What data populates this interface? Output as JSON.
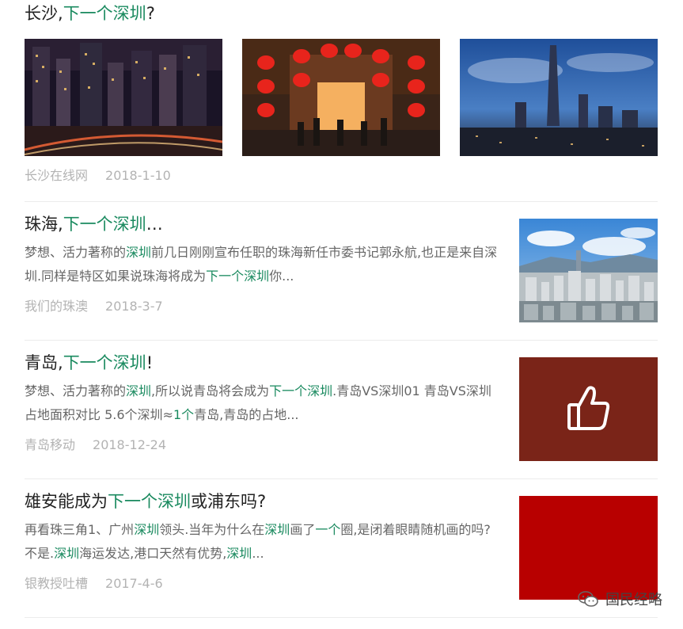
{
  "items": [
    {
      "title_parts": [
        {
          "text": "长沙,",
          "hl": false
        },
        {
          "text": "下一个深圳",
          "hl": true
        },
        {
          "text": "?",
          "hl": false
        }
      ],
      "images": [
        "changsha-night-skyline",
        "temple-lanterns-street",
        "shenzhen-dusk-skyline"
      ],
      "source": "长沙在线网",
      "date": "2018-1-10"
    },
    {
      "title_parts": [
        {
          "text": "珠海,",
          "hl": false
        },
        {
          "text": "下一个深圳",
          "hl": true
        },
        {
          "text": "…",
          "hl": false
        }
      ],
      "desc_parts": [
        {
          "text": "梦想、活力著称的",
          "hl": false
        },
        {
          "text": "深圳",
          "hl": true
        },
        {
          "text": "前几日刚刚宣布任职的珠海新任市委书记郭永航,也正是来自深圳.同样是特区如果说珠海将成为",
          "hl": false
        },
        {
          "text": "下一个深圳",
          "hl": true
        },
        {
          "text": "你...",
          "hl": false
        }
      ],
      "image": "city-panorama-blue-sky",
      "source": "我们的珠澳",
      "date": "2018-3-7"
    },
    {
      "title_parts": [
        {
          "text": "青岛,",
          "hl": false
        },
        {
          "text": "下一个深圳",
          "hl": true
        },
        {
          "text": "!",
          "hl": false
        }
      ],
      "desc_parts": [
        {
          "text": "梦想、活力著称的",
          "hl": false
        },
        {
          "text": "深圳",
          "hl": true
        },
        {
          "text": ",所以说青岛将会成为",
          "hl": false
        },
        {
          "text": "下一个深圳",
          "hl": true
        },
        {
          "text": ".青岛VS深圳01 青岛VS深圳占地面积对比 5.6个深圳≈",
          "hl": false
        },
        {
          "text": "1个",
          "hl": true
        },
        {
          "text": "青岛,青岛的占地...",
          "hl": false
        }
      ],
      "image": "thumbs-up-icon",
      "image_bg": "#7a2418",
      "source": "青岛移动",
      "date": "2018-12-24"
    },
    {
      "title_parts": [
        {
          "text": "雄安能成为",
          "hl": false
        },
        {
          "text": "下一个深圳",
          "hl": true
        },
        {
          "text": "或浦东吗?",
          "hl": false
        }
      ],
      "desc_parts": [
        {
          "text": "再看珠三角1、广州",
          "hl": false
        },
        {
          "text": "深圳",
          "hl": true
        },
        {
          "text": "领头.当年为什么在",
          "hl": false
        },
        {
          "text": "深圳",
          "hl": true
        },
        {
          "text": "画了",
          "hl": false
        },
        {
          "text": "一个",
          "hl": true
        },
        {
          "text": "圈,是闭着眼睛随机画的吗?不是.",
          "hl": false
        },
        {
          "text": "深圳",
          "hl": true
        },
        {
          "text": "海运发达,港口天然有优势,",
          "hl": false
        },
        {
          "text": "深圳",
          "hl": true
        },
        {
          "text": "...",
          "hl": false
        }
      ],
      "image": "solid-red-block",
      "image_bg": "#b80000",
      "source": "银教授吐槽",
      "date": "2017-4-6"
    }
  ],
  "watermark": {
    "icon": "wechat-icon",
    "text": "国民经略"
  },
  "colors": {
    "highlight": "#1a8a5f",
    "meta": "#b3b3b3",
    "divider": "#ececec"
  }
}
